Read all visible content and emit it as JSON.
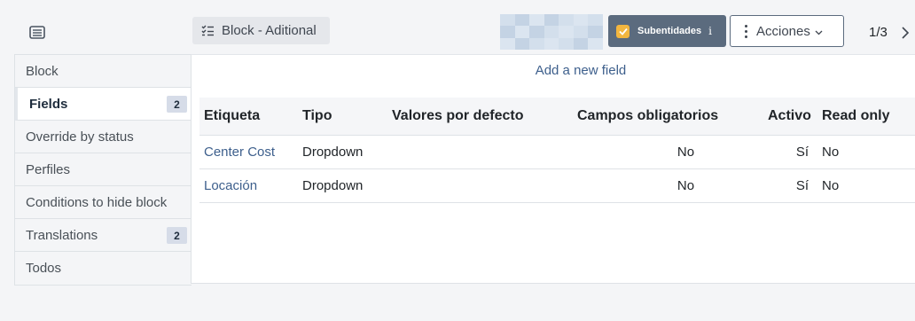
{
  "header": {
    "menu_icon": "sidebar-toggle-icon",
    "block_title": "Block - Aditional",
    "subentidades": {
      "label": "Subentidades",
      "checked": true,
      "info": "i"
    },
    "acciones_label": "Acciones",
    "pager": "1/3"
  },
  "sidebar": {
    "items": [
      {
        "label": "Block",
        "badge": ""
      },
      {
        "label": "Fields",
        "badge": "2"
      },
      {
        "label": "Override by status",
        "badge": ""
      },
      {
        "label": "Perfiles",
        "badge": ""
      },
      {
        "label": "Conditions to hide block",
        "badge": ""
      },
      {
        "label": "Translations",
        "badge": "2"
      },
      {
        "label": "Todos",
        "badge": ""
      }
    ]
  },
  "main": {
    "add_field": "Add a new field",
    "table": {
      "headers": [
        "Etiqueta",
        "Tipo",
        "Valores por defecto",
        "Campos obligatorios",
        "Activo",
        "Read only"
      ],
      "rows": [
        [
          "Center Cost",
          "Dropdown",
          "",
          "No",
          "Sí",
          "No"
        ],
        [
          "Locación",
          "Dropdown",
          "",
          "No",
          "Sí",
          "No"
        ]
      ]
    }
  },
  "colors": {
    "accent": "#3d5f8c",
    "subentidades_bg": "#5b6b7e",
    "checkbox": "#f3b63f",
    "badge_bg": "#d6dce8"
  }
}
